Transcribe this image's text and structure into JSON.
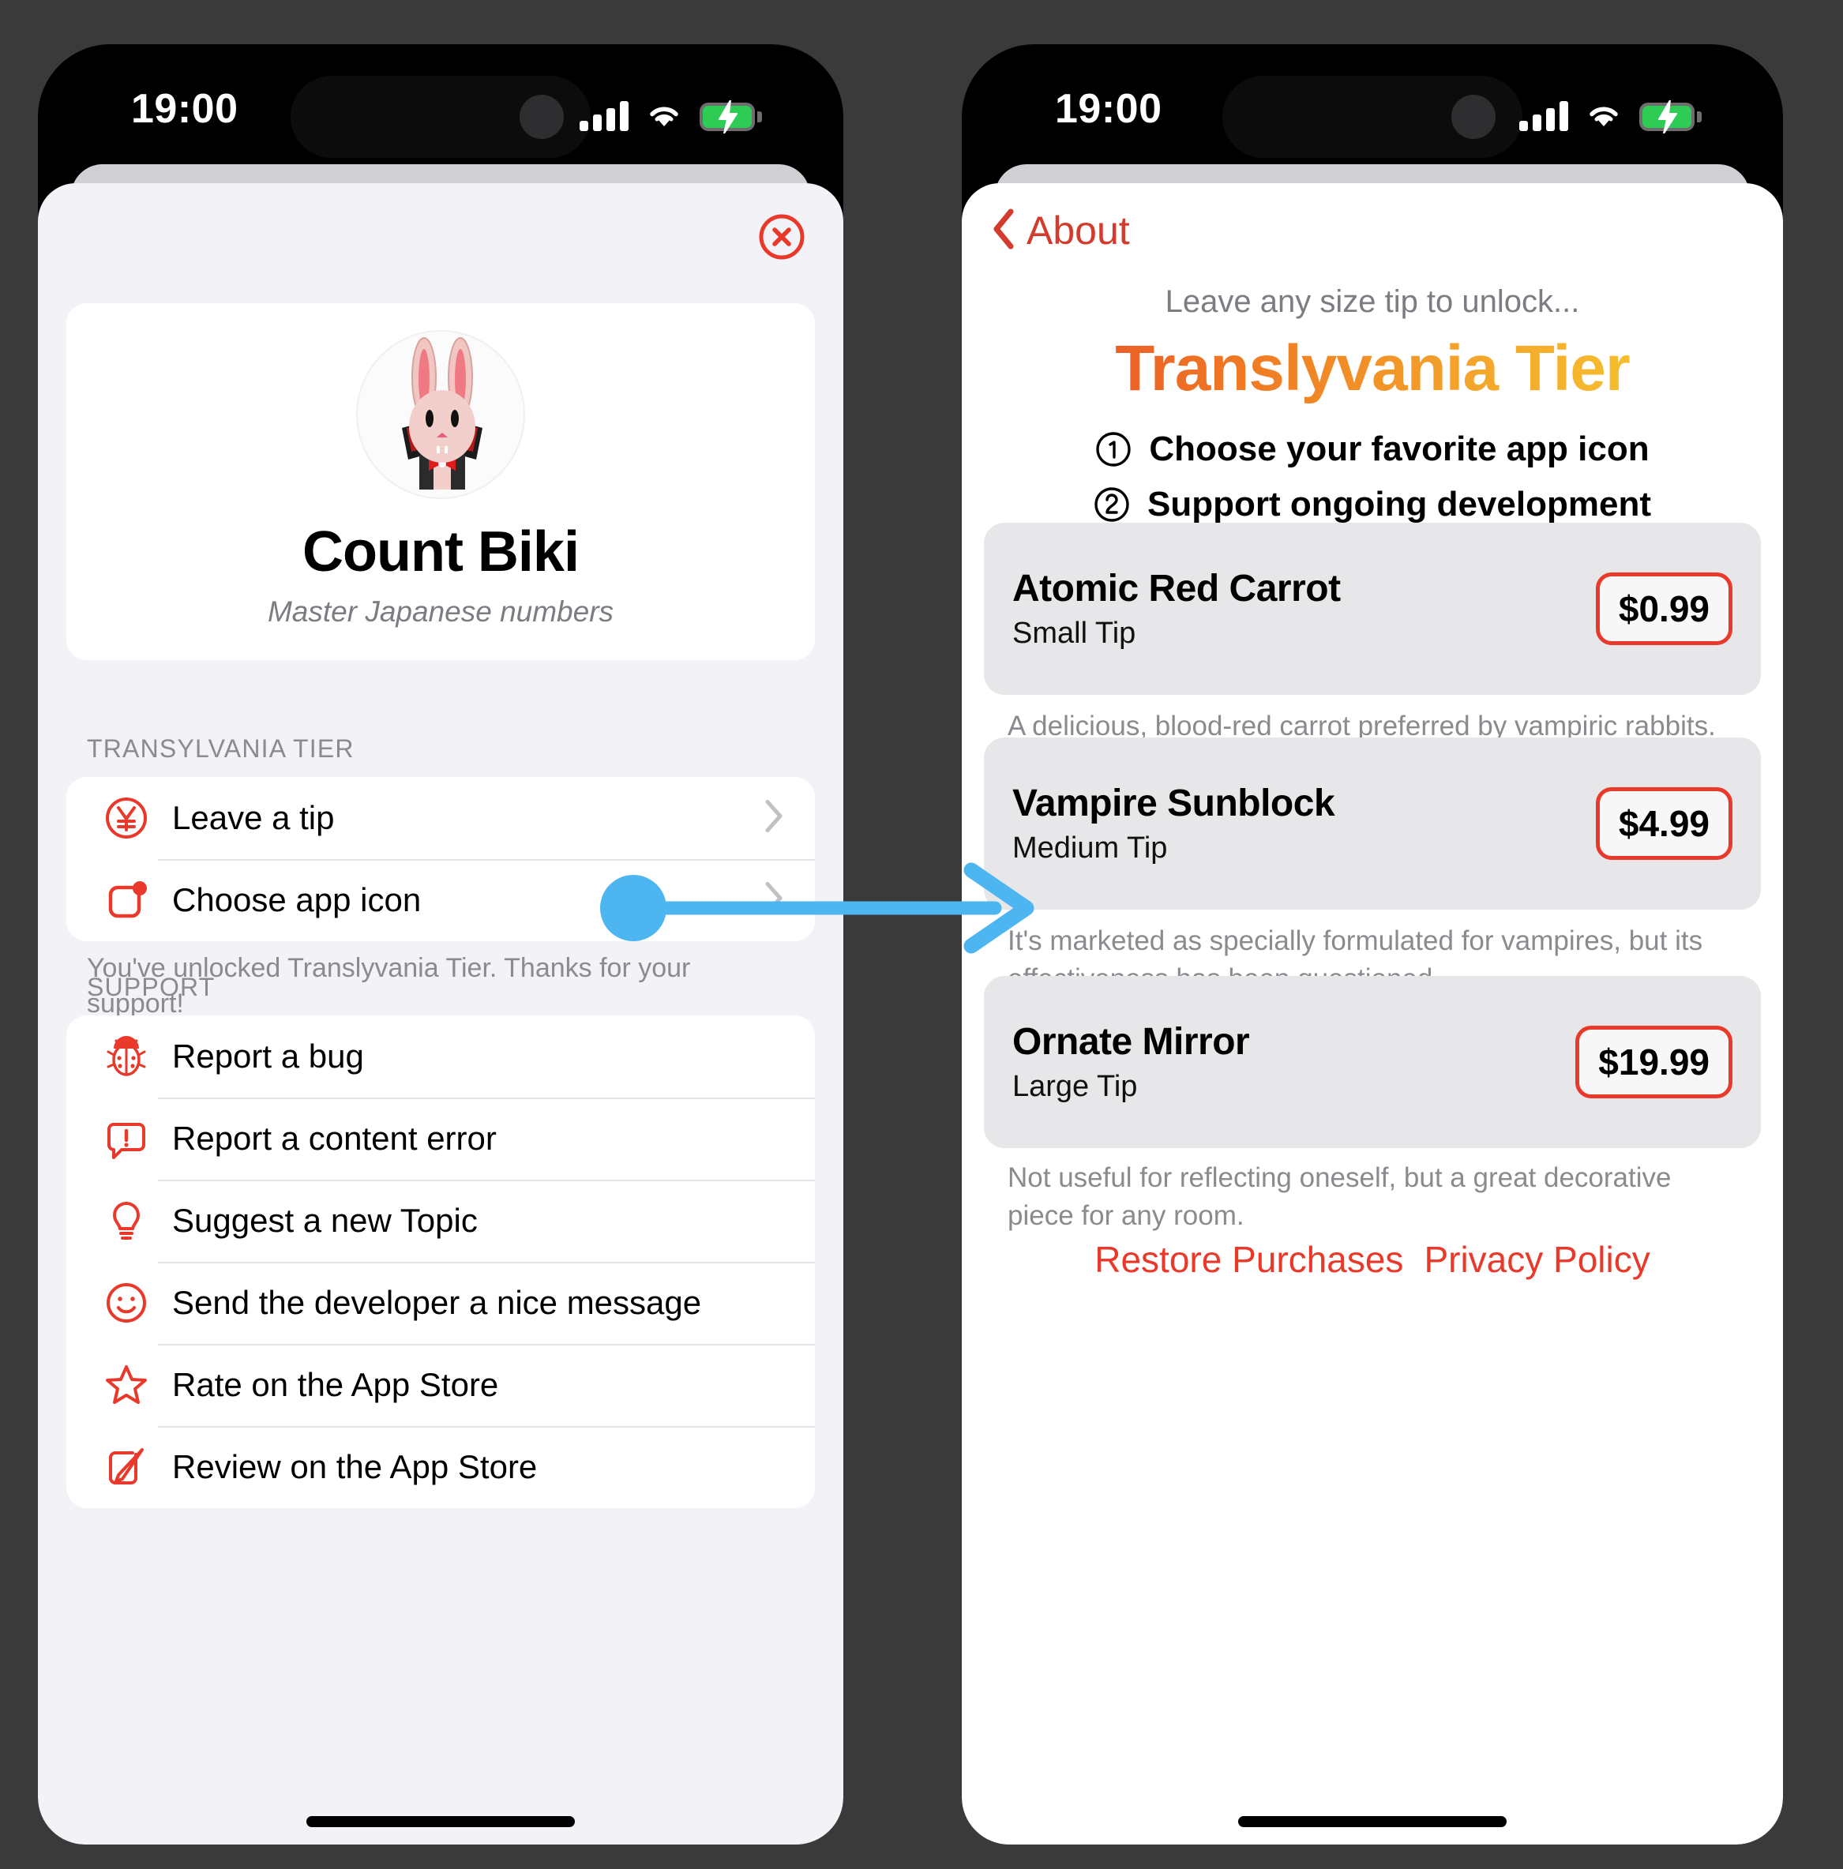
{
  "accent": {
    "red": "#e8392b",
    "nav_red": "#d33b2c",
    "blue_annotation": "#4db5f0",
    "battery_green": "#2ecc55"
  },
  "status_bar": {
    "time": "19:00",
    "signal_icon": "cellular-signal-icon",
    "wifi_icon": "wifi-icon",
    "battery_icon": "battery-charging-icon"
  },
  "left_phone": {
    "close_label": "close-icon",
    "hero": {
      "avatar_icon": "vampire-bunny-avatar",
      "name": "Count Biki",
      "subtitle": "Master Japanese numbers"
    },
    "tier_section": {
      "header": "TRANSYLVANIA TIER",
      "rows": [
        {
          "label": "Leave a tip",
          "icon": "yen-circle-icon"
        },
        {
          "label": "Choose app icon",
          "icon": "app-icon-badge-icon"
        }
      ],
      "footnote": "You've unlocked Translyvania Tier. Thanks for your support!"
    },
    "support_section": {
      "header": "SUPPORT",
      "rows": [
        {
          "label": "Report a bug",
          "icon": "ladybug-icon"
        },
        {
          "label": "Report a content error",
          "icon": "exclamation-bubble-icon"
        },
        {
          "label": "Suggest a new Topic",
          "icon": "lightbulb-icon"
        },
        {
          "label": "Send the developer a nice message",
          "icon": "smiley-face-icon"
        },
        {
          "label": "Rate on the App Store",
          "icon": "star-icon"
        },
        {
          "label": "Review on the App Store",
          "icon": "pencil-square-icon"
        }
      ]
    }
  },
  "right_phone": {
    "nav": {
      "back_icon": "chevron-left-icon",
      "back_label": "About"
    },
    "lead_text": "Leave any size tip to unlock...",
    "title": "Translyvania Tier",
    "bullets": [
      {
        "number": "1",
        "text": "Choose your favorite app icon"
      },
      {
        "number": "2",
        "text": "Support ongoing development"
      }
    ],
    "tips": [
      {
        "name": "Atomic Red Carrot",
        "size": "Small Tip",
        "price": "$0.99",
        "description": "A delicious, blood-red carrot preferred by vampiric rabbits."
      },
      {
        "name": "Vampire Sunblock",
        "size": "Medium Tip",
        "price": "$4.99",
        "description": "It's marketed as specially formulated for vampires, but its effectiveness has been questioned."
      },
      {
        "name": "Ornate Mirror",
        "size": "Large Tip",
        "price": "$19.99",
        "description": "Not useful for reflecting oneself, but a great decorative piece for any room."
      }
    ],
    "footer": {
      "restore": "Restore Purchases",
      "privacy": "Privacy Policy"
    }
  },
  "annotation": {
    "type": "arrow",
    "from": "leave-a-tip-row",
    "to": "tip-detail-screen"
  }
}
